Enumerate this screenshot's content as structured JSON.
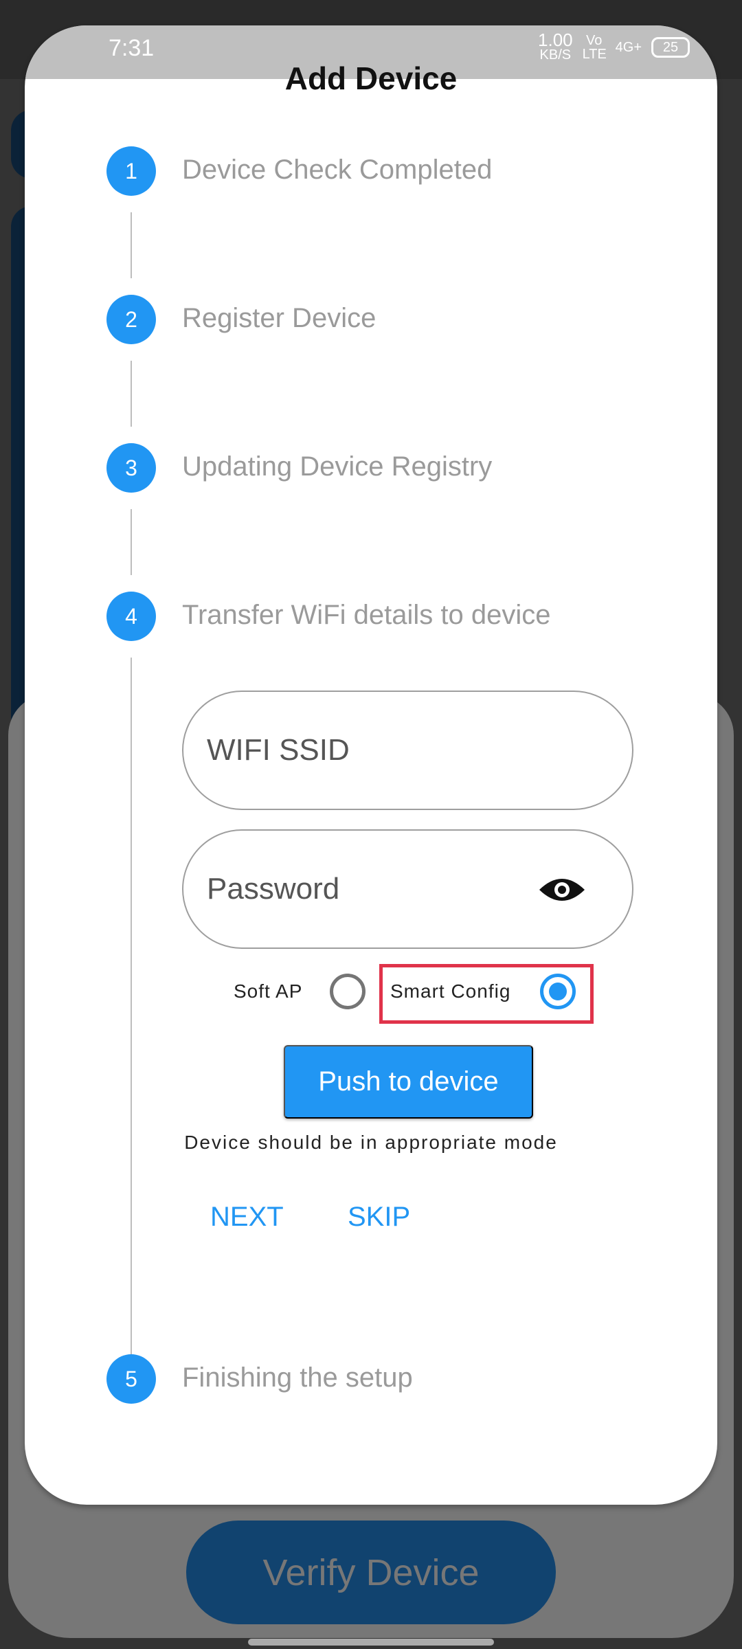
{
  "status_bar": {
    "time": "7:31",
    "speed": "1.00",
    "speed_unit": "KB/S",
    "volte": "Vo LTE",
    "network": "4G+",
    "battery": "25"
  },
  "dialog": {
    "title": "Add Device"
  },
  "steps": [
    {
      "number": "1",
      "label": "Device Check Completed"
    },
    {
      "number": "2",
      "label": "Register Device"
    },
    {
      "number": "3",
      "label": "Updating Device Registry"
    },
    {
      "number": "4",
      "label": "Transfer WiFi details to device"
    },
    {
      "number": "5",
      "label": "Finishing the setup"
    }
  ],
  "form": {
    "ssid_placeholder": "WIFI SSID",
    "password_placeholder": "Password",
    "password_icon": "eye-icon",
    "mode_options": [
      {
        "label": "Soft AP",
        "selected": false
      },
      {
        "label": "Smart Config",
        "selected": true
      }
    ],
    "push_label": "Push to device",
    "hint": "Device should be in appropriate mode",
    "next_label": "NEXT",
    "skip_label": "SKIP"
  },
  "background": {
    "verify_label": "Verify Device"
  },
  "colors": {
    "accent": "#2196f3",
    "highlight": "#e0334a",
    "verify_bg": "#11436f"
  }
}
